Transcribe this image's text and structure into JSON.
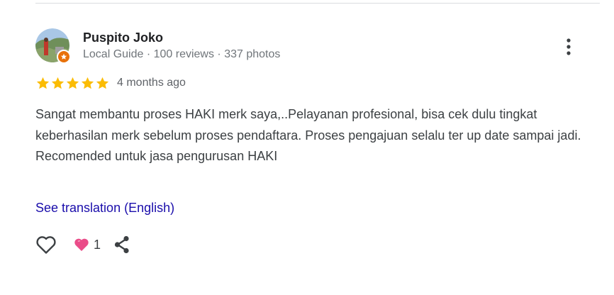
{
  "reviewer": {
    "name": "Puspito Joko",
    "meta": "Local Guide · 100 reviews · 337 photos"
  },
  "review": {
    "rating": 5,
    "max_rating": 5,
    "date": "4 months ago",
    "text_lines": [
      "Sangat membantu proses HAKI merk saya,..Pelayanan profesional, bisa cek dulu tingkat keberhasilan merk sebelum proses pendaftara. Proses pengajuan selalu ter up date sampai jadi.",
      "Recomended untuk jasa pengurusan HAKI"
    ],
    "translation_link": "See translation (English)"
  },
  "reactions": {
    "count": "1"
  },
  "colors": {
    "star": "#fbbc04",
    "link": "#1a0dab",
    "heart_reaction": "#ea4c89",
    "local_guide_badge": "#e8710a"
  },
  "icons": {
    "more": "more-vert-icon",
    "like": "heart-outline-icon",
    "reaction": "heart-filled-icon",
    "share": "share-icon",
    "star": "star-icon",
    "badge": "local-guide-badge-icon"
  }
}
